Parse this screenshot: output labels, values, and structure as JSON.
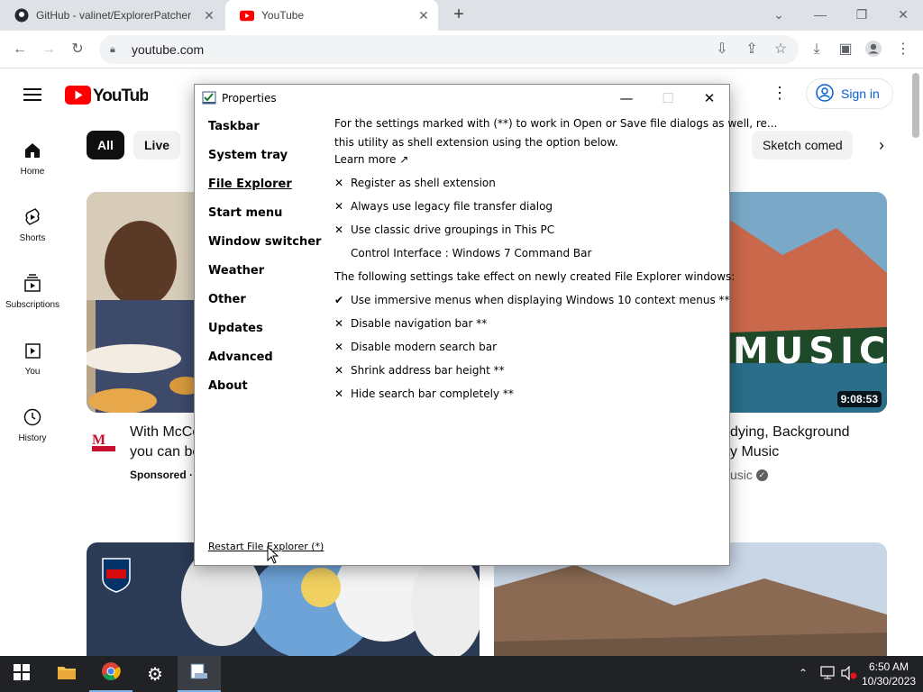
{
  "browser": {
    "tabs": [
      {
        "label": "GitHub - valinet/ExplorerPatcher",
        "icon": "github-icon"
      },
      {
        "label": "YouTube",
        "icon": "youtube-icon"
      }
    ],
    "new_tab": "+",
    "url": "youtube.com"
  },
  "youtube": {
    "sign_in": "Sign in",
    "sidebar": [
      {
        "label": "Home",
        "icon": "home-icon"
      },
      {
        "label": "Shorts",
        "icon": "shorts-icon"
      },
      {
        "label": "Subscriptions",
        "icon": "subscriptions-icon"
      },
      {
        "label": "You",
        "icon": "you-icon"
      },
      {
        "label": "History",
        "icon": "history-icon"
      }
    ],
    "chips": [
      "All",
      "Live",
      "Sketch comed"
    ],
    "videos": [
      {
        "title_line1": "With McCo",
        "title_line2": "you can be",
        "meta": "Sponsored ·"
      },
      {
        "title_line1": "dying, Background",
        "title_line2": "y Music",
        "meta": "usic",
        "duration": "9:08:53",
        "overlay": "MUSIC"
      }
    ]
  },
  "dialog": {
    "title": "Properties",
    "nav": [
      "Taskbar",
      "System tray",
      "File Explorer",
      "Start menu",
      "Window switcher",
      "Weather",
      "Other",
      "Updates",
      "Advanced",
      "About"
    ],
    "active_nav": "File Explorer",
    "intro_line1": "For the settings marked with (**) to work in Open or Save file dialogs as well, re...",
    "intro_line2": "this utility as shell extension using the option below.",
    "learn_more": "Learn more ↗",
    "opt1": "Register as shell extension",
    "opt2": "Always use legacy file transfer dialog",
    "opt3": "Use classic drive groupings in This PC",
    "control_interface": "Control Interface : Windows 7 Command Bar",
    "section2": "The following settings take effect on newly created File Explorer windows:",
    "opt4": "Use immersive menus when displaying Windows 10 context menus **",
    "opt5": "Disable navigation bar **",
    "opt6": "Disable modern search bar",
    "opt7": "Shrink address bar height **",
    "opt8": "Hide search bar completely **",
    "restart": "Restart File Explorer (*)",
    "mark_x": "✕",
    "mark_check": "✔"
  },
  "taskbar": {
    "time": "6:50 AM",
    "date": "10/30/2023"
  }
}
